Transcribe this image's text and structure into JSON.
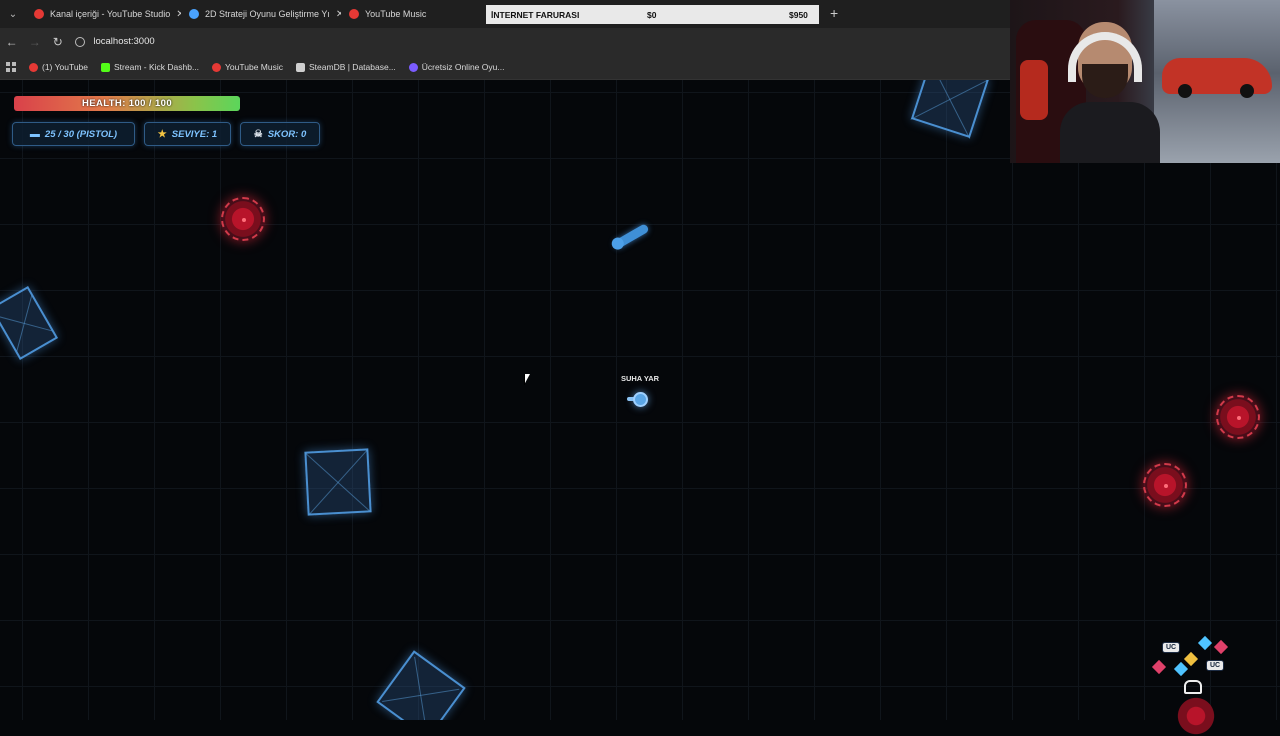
{
  "browser": {
    "tabs": [
      {
        "label": "Kanal içeriği - YouTube Studio",
        "color": "#e53935",
        "closable": true
      },
      {
        "label": "2D Strateji Oyunu Geliştirme Yı",
        "color": "#4aa3ff",
        "closable": true
      },
      {
        "label": "YouTube Music",
        "color": "#e53935",
        "closable": false
      }
    ],
    "new_tab_symbol": "+",
    "url": "localhost:3000",
    "bookmarks": [
      {
        "label": "(1) YouTube",
        "color": "#e53935"
      },
      {
        "label": "Stream - Kick Dashb...",
        "color": "#53fc18"
      },
      {
        "label": "YouTube Music",
        "color": "#e53935"
      },
      {
        "label": "SteamDB | Database...",
        "color": "#cfcfcf"
      },
      {
        "label": "Ücretsiz Online Oyu...",
        "color": "#7b5cff"
      }
    ]
  },
  "donation_bar": {
    "label": "İNTERNET FARURASI",
    "current": "$0",
    "goal": "$950"
  },
  "hud": {
    "health_text": "HEALTH: 100 / 100",
    "health_fraction": 1.0,
    "ammo_text": "25 / 30 (PISTOL)",
    "level_text": "SEVIYE: 1",
    "score_text": "SKOR: 0",
    "accent": "#7ec3ff"
  },
  "player": {
    "name": "SUHA YAR"
  },
  "logo": {
    "badge_text": "UC"
  }
}
